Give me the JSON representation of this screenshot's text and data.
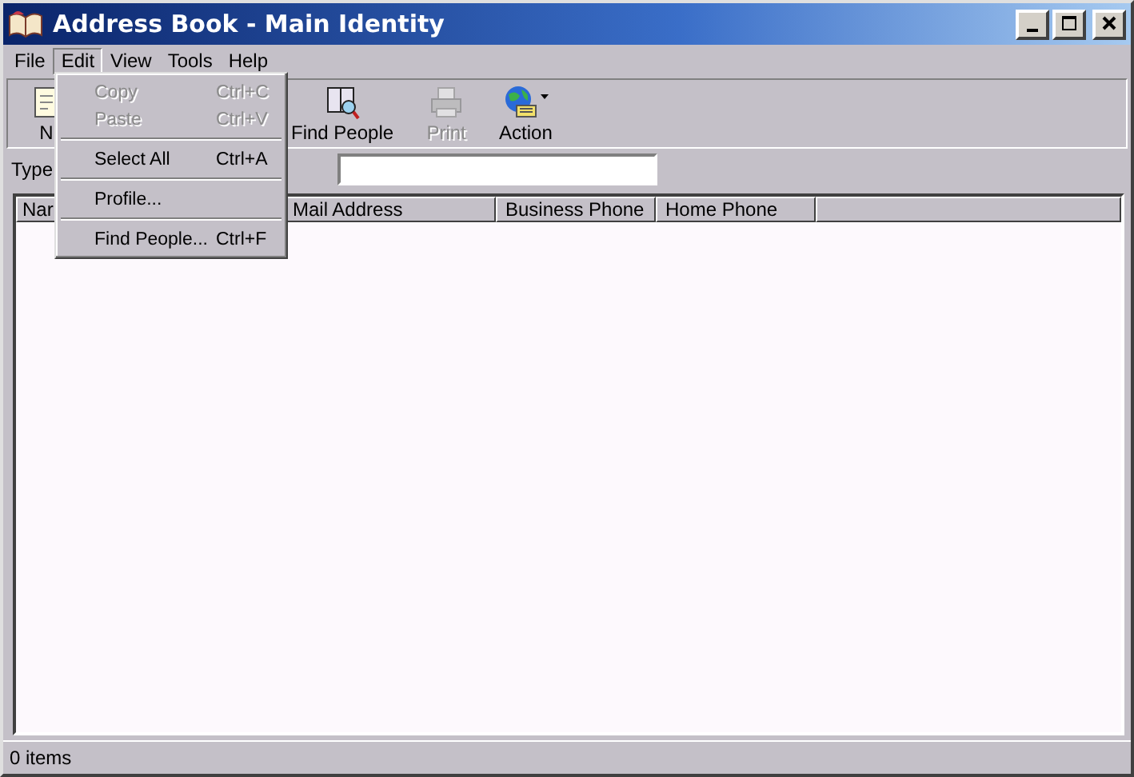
{
  "window": {
    "title": "Address Book - Main Identity"
  },
  "menu_bar": [
    {
      "label": "File",
      "selected": false
    },
    {
      "label": "Edit",
      "selected": true
    },
    {
      "label": "View",
      "selected": false
    },
    {
      "label": "Tools",
      "selected": false
    },
    {
      "label": "Help",
      "selected": false
    }
  ],
  "edit_menu": [
    {
      "kind": "item",
      "label": "Copy",
      "shortcut": "Ctrl+C",
      "disabled": true
    },
    {
      "kind": "item",
      "label": "Paste",
      "shortcut": "Ctrl+V",
      "disabled": true
    },
    {
      "kind": "separator"
    },
    {
      "kind": "item",
      "label": "Select All",
      "shortcut": "Ctrl+A",
      "disabled": false
    },
    {
      "kind": "separator"
    },
    {
      "kind": "item",
      "label": "Profile...",
      "disabled": false
    },
    {
      "kind": "separator"
    },
    {
      "kind": "item",
      "label": "Find People...",
      "shortcut": "Ctrl+F",
      "disabled": false
    }
  ],
  "toolbar": [
    {
      "kind": "new",
      "label": "N",
      "disabled": false
    },
    {
      "kind": "gap"
    },
    {
      "kind": "find",
      "label": "Find People",
      "disabled": false
    },
    {
      "kind": "print",
      "label": "Print",
      "disabled": true
    },
    {
      "kind": "action",
      "label": "Action",
      "disabled": false
    }
  ],
  "type_row": {
    "label": "Type"
  },
  "table": {
    "columns": [
      "Nar",
      "Mail Address",
      "Business Phone",
      "Home Phone"
    ]
  },
  "status_bar": {
    "text": "0 items"
  }
}
